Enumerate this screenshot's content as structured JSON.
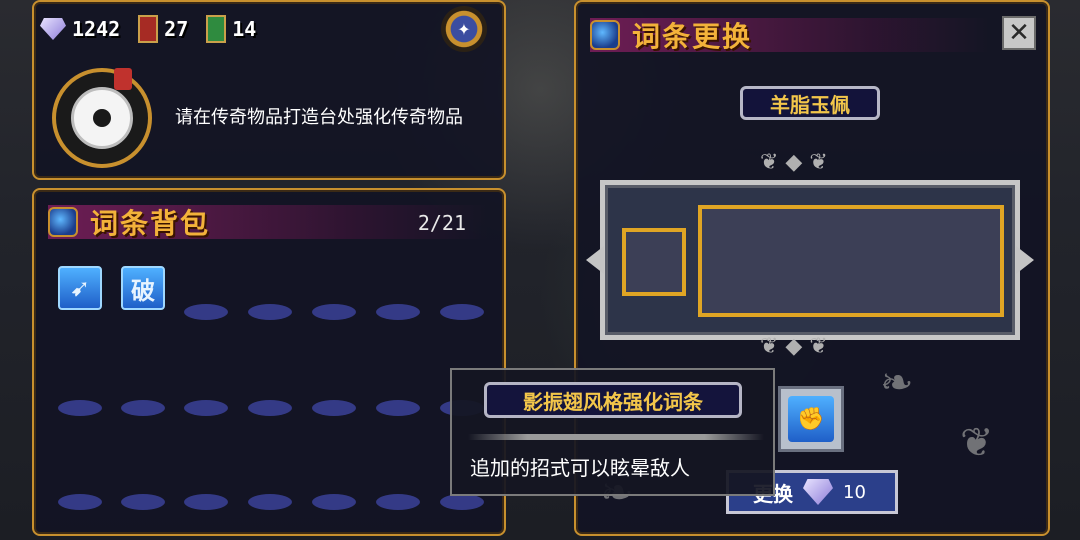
{
  "currencies": {
    "gems": "1242",
    "red_cards": "27",
    "green_cards": "14"
  },
  "info_panel": {
    "hint": "请在传奇物品打造台处强化传奇物品"
  },
  "inventory": {
    "title": "词条背包",
    "count": "2/21",
    "skills": [
      {
        "glyph": "➹"
      },
      {
        "glyph": "破"
      }
    ]
  },
  "replace_panel": {
    "title": "词条更换",
    "close_glyph": "✕",
    "item_name": "羊脂玉佩",
    "change_button": "更换",
    "cost": "10"
  },
  "tooltip": {
    "name": "影振翅风格强化词条",
    "description": "追加的招式可以眩晕敌人",
    "preview_glyph": "✊"
  }
}
